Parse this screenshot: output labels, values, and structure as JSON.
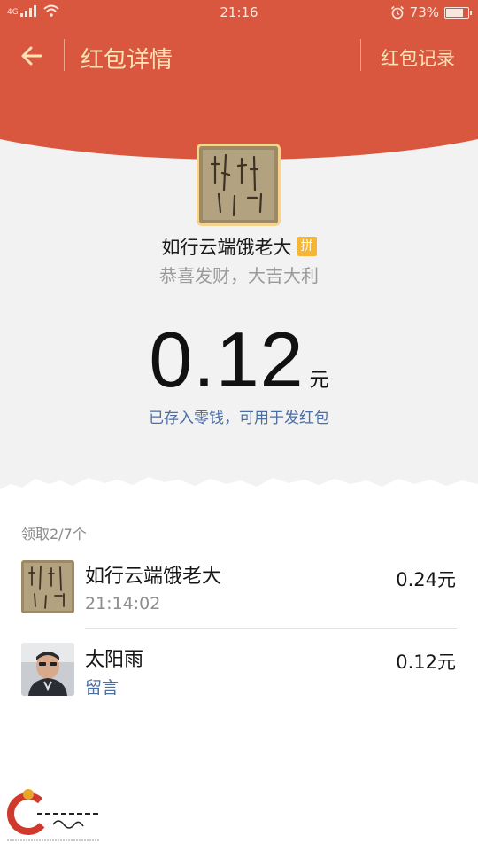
{
  "status_bar": {
    "time": "21:16",
    "network": "4G",
    "battery": "73%",
    "battery_level": 0.73
  },
  "header": {
    "title": "红包详情",
    "records_link": "红包记录"
  },
  "icons": {
    "back": "arrow-left-icon",
    "pin": "pin-badge",
    "alarm": "alarm-clock-icon",
    "wifi": "wifi-icon",
    "signal": "signal-icon"
  },
  "sender": {
    "name": "如行云端饿老大",
    "badge": "拼",
    "greeting": "恭喜发财，大吉大利"
  },
  "amount": {
    "value": "0.12",
    "unit": "元",
    "note": "已存入零钱，可用于发红包"
  },
  "claims": {
    "count_label": "领取2/7个",
    "items": [
      {
        "name": "如行云端饿老大",
        "sub": "21:14:02",
        "amount": "0.24元"
      },
      {
        "name": "太阳雨",
        "sub": "留言",
        "amount": "0.12元"
      }
    ]
  },
  "colors": {
    "header_red": "#d9573f",
    "gold_text": "#fbe3b6",
    "link_blue": "#4a6fa5",
    "badge_yellow": "#f4b634"
  }
}
